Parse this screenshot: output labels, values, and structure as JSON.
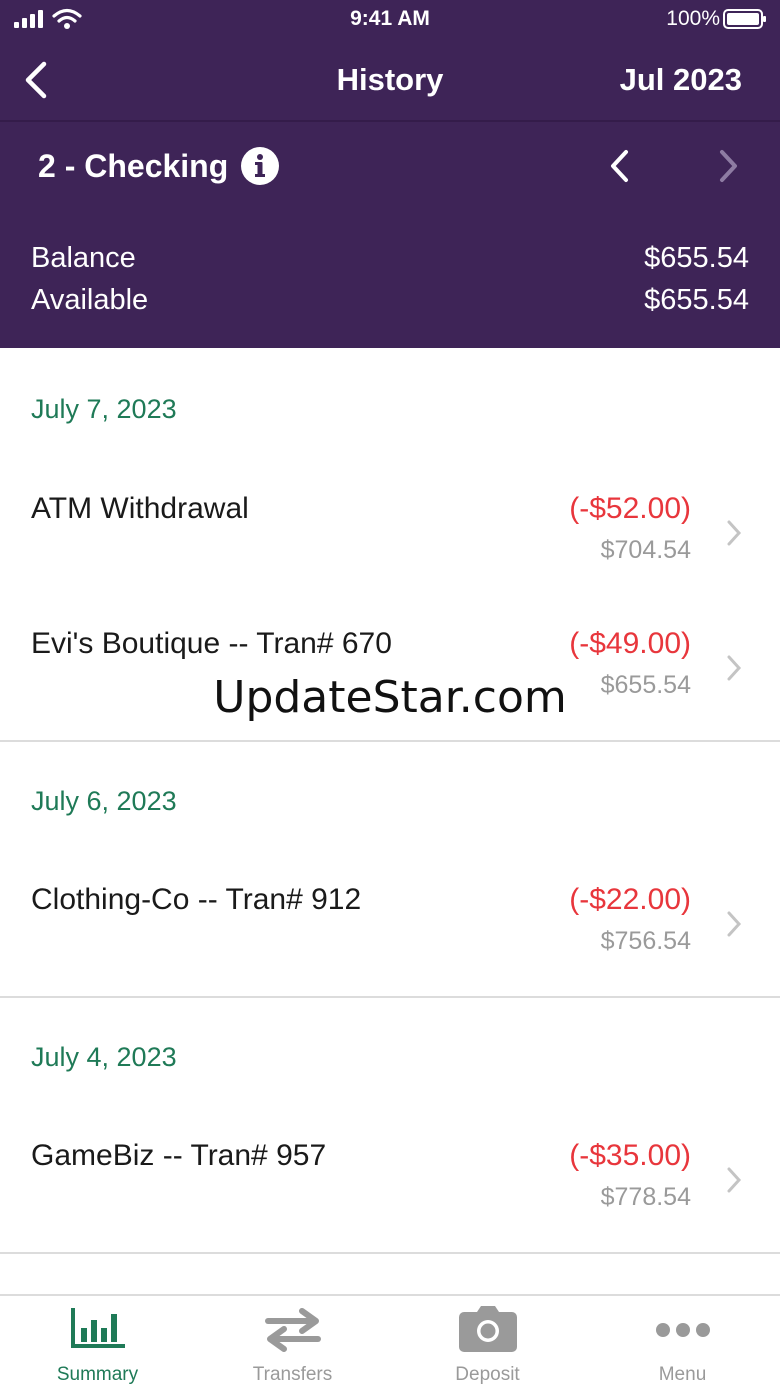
{
  "status_bar": {
    "time": "9:41 AM",
    "battery": "100%"
  },
  "nav": {
    "title": "History",
    "month": "Jul 2023"
  },
  "account": {
    "name": "2 - Checking",
    "balance_label": "Balance",
    "balance": "$655.54",
    "available_label": "Available",
    "available": "$655.54"
  },
  "groups": [
    {
      "date": "July 7, 2023",
      "transactions": [
        {
          "description": "ATM Withdrawal",
          "amount": "(-$52.00)",
          "running_balance": "$704.54"
        },
        {
          "description": "Evi's Boutique -- Tran# 670",
          "amount": "(-$49.00)",
          "running_balance": "$655.54"
        }
      ]
    },
    {
      "date": "July 6, 2023",
      "transactions": [
        {
          "description": "Clothing-Co -- Tran# 912",
          "amount": "(-$22.00)",
          "running_balance": "$756.54"
        }
      ]
    },
    {
      "date": "July 4, 2023",
      "transactions": [
        {
          "description": "GameBiz -- Tran# 957",
          "amount": "(-$35.00)",
          "running_balance": "$778.54"
        }
      ]
    }
  ],
  "watermark": "UpdateStar.com",
  "tabs": [
    {
      "label": "Summary",
      "icon": "bar-chart-icon",
      "active": true
    },
    {
      "label": "Transfers",
      "icon": "transfer-arrows-icon",
      "active": false
    },
    {
      "label": "Deposit",
      "icon": "camera-icon",
      "active": false
    },
    {
      "label": "Menu",
      "icon": "more-dots-icon",
      "active": false
    }
  ],
  "colors": {
    "header_bg": "#3e2457",
    "accent_green": "#1f7a57",
    "debit_red": "#e8363c",
    "muted_gray": "#9a9a9a"
  }
}
